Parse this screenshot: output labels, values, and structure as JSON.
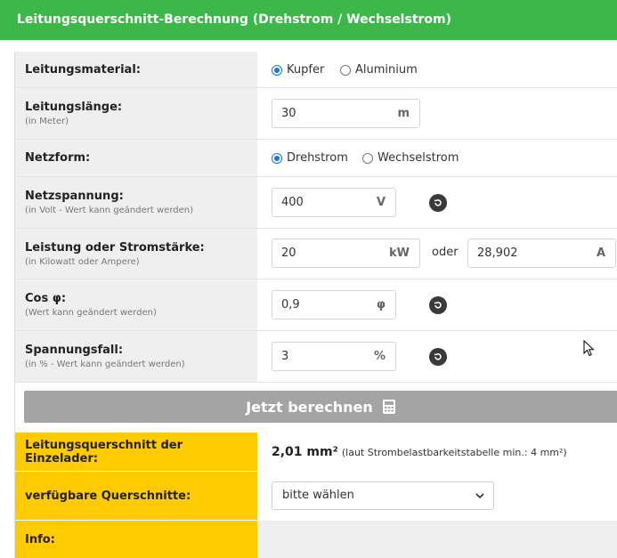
{
  "header": {
    "title": "Leitungsquerschnitt-Berechnung (Drehstrom / Wechselstrom)"
  },
  "form": {
    "material": {
      "label": "Leitungsmaterial:",
      "options": [
        "Kupfer",
        "Aluminium"
      ],
      "selected": "Kupfer"
    },
    "laenge": {
      "label": "Leitungslänge:",
      "sub": "(in Meter)",
      "value": "30",
      "unit": "m"
    },
    "netzform": {
      "label": "Netzform:",
      "options": [
        "Drehstrom",
        "Wechselstrom"
      ],
      "selected": "Drehstrom"
    },
    "spannung": {
      "label": "Netzspannung:",
      "sub": "(in Volt - Wert kann geändert werden)",
      "value": "400",
      "unit": "V"
    },
    "leistung": {
      "label": "Leistung oder Stromstärke:",
      "sub": "(in Kilowatt oder Ampere)",
      "value": "20",
      "unit": "kW",
      "or": "oder",
      "value2": "28,902",
      "unit2": "A"
    },
    "cosphi": {
      "label": "Cos φ:",
      "sub": "(Wert kann geändert werden)",
      "value": "0,9",
      "unit": "φ"
    },
    "spannungsfall": {
      "label": "Spannungsfall:",
      "sub": "(in % - Wert kann geändert werden)",
      "value": "3",
      "unit": "%"
    }
  },
  "button": {
    "label": "Jetzt berechnen",
    "icon": "calculator-icon"
  },
  "result": {
    "einzelader": {
      "label": "Leitungsquerschnitt der Einzelader:",
      "value": "2,01 mm²",
      "note": "(laut Strombelastbarkeitstabelle min.: 4 mm²)"
    },
    "verfuegbar": {
      "label": "verfügbare Querschnitte:",
      "selected": "bitte wählen"
    },
    "info": {
      "label": "Info:"
    }
  },
  "colors": {
    "header": "#3db74a",
    "highlight": "#fecb00",
    "button": "#a4a4a4",
    "radio": "#1a73e8"
  }
}
